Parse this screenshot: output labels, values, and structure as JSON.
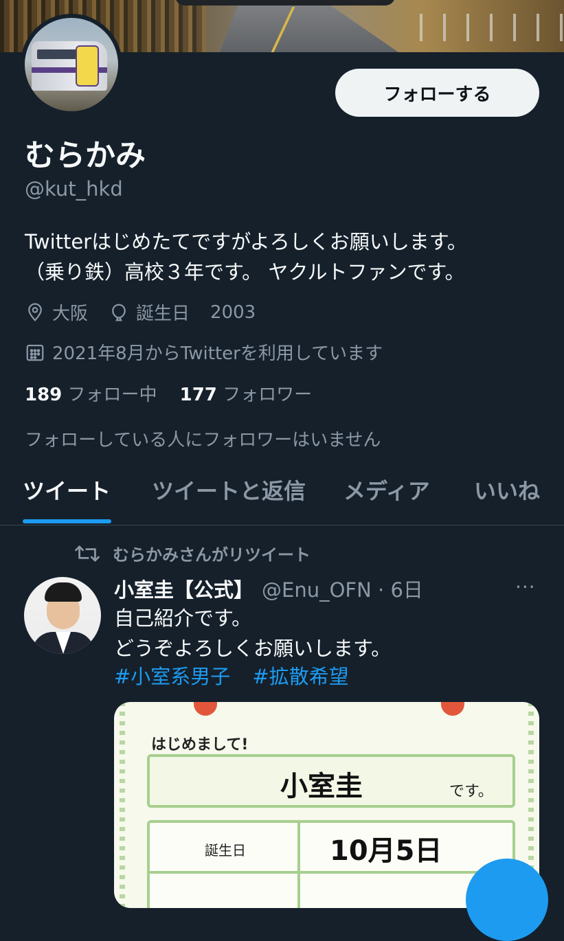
{
  "profile": {
    "display_name": "むらかみ",
    "handle": "@kut_hkd",
    "follow_button": "フォローする",
    "bio_line1": "Twitterはじめたてですがよろしくお願いします。",
    "bio_line2": "（乗り鉄）高校３年です。 ヤクルトファンです。",
    "location": "大阪",
    "birthday_label": "誕生日",
    "birthday_value": "2003",
    "joined": "2021年8月からTwitterを利用しています",
    "following_count": "189",
    "following_label": "フォロー中",
    "followers_count": "177",
    "followers_label": "フォロワー",
    "mutual_note": "フォローしている人にフォロワーはいません"
  },
  "tabs": [
    {
      "label": "ツイート",
      "active": true
    },
    {
      "label": "ツイートと返信",
      "active": false
    },
    {
      "label": "メディア",
      "active": false
    },
    {
      "label": "いいね",
      "active": false
    }
  ],
  "tweet": {
    "retweet_note": "むらかみさんがリツイート",
    "author_name": "小室圭【公式】",
    "author_handle_time": "@Enu_OFN · 6日",
    "more": "···",
    "text_line1": "自己紹介です。",
    "text_line2": "どうぞよろしくお願いします。",
    "hashtags": [
      "#小室系男子",
      "#拡散希望"
    ],
    "card": {
      "hello": "はじめまして!",
      "name": "小室圭",
      "desu": "です。",
      "birthday_label": "誕生日",
      "birthday_value": "10月5日"
    }
  },
  "icons": {
    "location": "location-pin-icon",
    "birthday": "balloon-icon",
    "joined": "calendar-icon",
    "retweet": "retweet-icon",
    "more": "more-icon"
  },
  "colors": {
    "background": "#15202b",
    "accent": "#1d9bf0",
    "muted_text": "#8b98a5"
  }
}
